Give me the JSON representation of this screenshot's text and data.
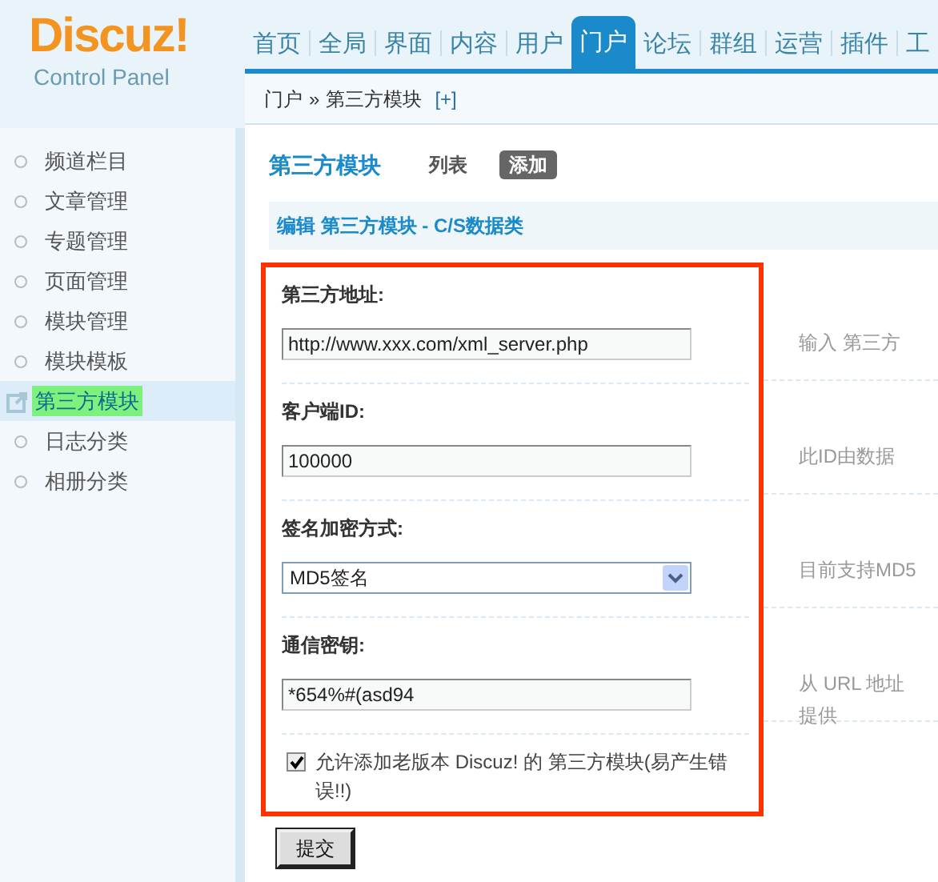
{
  "logo": {
    "name": "Discuz!",
    "subtitle": "Control Panel"
  },
  "nav": [
    {
      "label": "首页",
      "selected": false
    },
    {
      "label": "全局",
      "selected": false
    },
    {
      "label": "界面",
      "selected": false
    },
    {
      "label": "内容",
      "selected": false
    },
    {
      "label": "用户",
      "selected": false
    },
    {
      "label": "门户",
      "selected": true
    },
    {
      "label": "论坛",
      "selected": false
    },
    {
      "label": "群组",
      "selected": false
    },
    {
      "label": "运营",
      "selected": false
    },
    {
      "label": "插件",
      "selected": false
    },
    {
      "label": "工",
      "selected": false
    }
  ],
  "breadcrumb": {
    "items": [
      "门户",
      "第三方模块"
    ],
    "separator": "»",
    "add": "[+]"
  },
  "sidebar": {
    "items": [
      {
        "label": "频道栏目",
        "selected": false
      },
      {
        "label": "文章管理",
        "selected": false
      },
      {
        "label": "专题管理",
        "selected": false
      },
      {
        "label": "页面管理",
        "selected": false
      },
      {
        "label": "模块管理",
        "selected": false
      },
      {
        "label": "模块模板",
        "selected": false
      },
      {
        "label": "第三方模块",
        "selected": true
      },
      {
        "label": "日志分类",
        "selected": false
      },
      {
        "label": "相册分类",
        "selected": false
      }
    ]
  },
  "page": {
    "title": "第三方模块",
    "tabs": [
      {
        "label": "列表",
        "selected": false
      },
      {
        "label": "添加",
        "selected": true
      }
    ],
    "section_title": "编辑 第三方模块 - C/S数据类"
  },
  "form": {
    "highlighted": true,
    "fields": [
      {
        "kind": "text",
        "label": "第三方地址:",
        "value": "http://www.xxx.com/xml_server.php",
        "hint": [
          "输入 第三方"
        ]
      },
      {
        "kind": "text",
        "label": "客户端ID:",
        "value": "100000",
        "hint": [
          "此ID由数据"
        ]
      },
      {
        "kind": "select",
        "label": "签名加密方式:",
        "value": "MD5签名",
        "hint": [
          "目前支持MD5"
        ]
      },
      {
        "kind": "text",
        "label": "通信密钥:",
        "value": "*654%#(asd94",
        "hint": [
          "从 URL 地址",
          "提供"
        ]
      }
    ],
    "checkbox": {
      "label": "允许添加老版本 Discuz! 的 第三方模块(易产生错误!!)",
      "checked": true
    },
    "submit": "提交"
  }
}
